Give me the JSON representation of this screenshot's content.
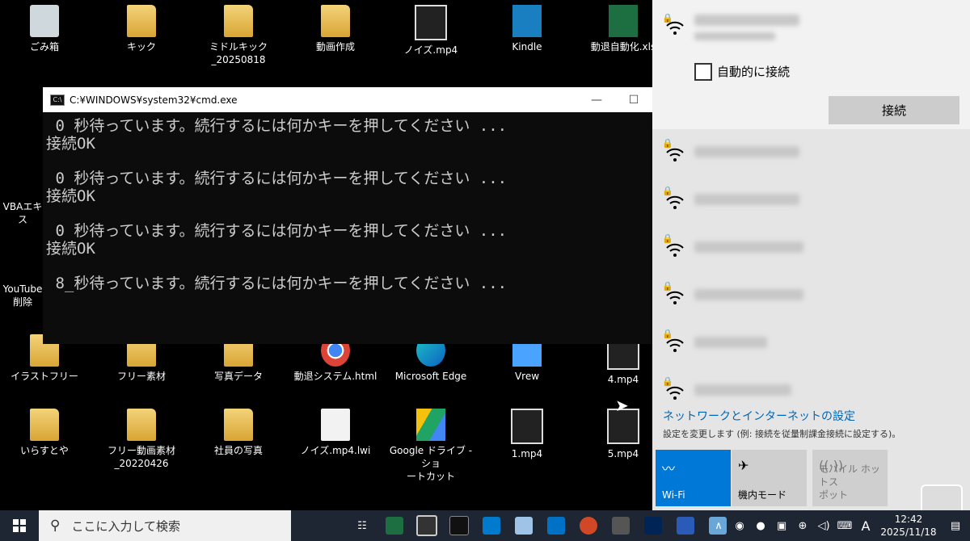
{
  "desktop": {
    "row1": [
      {
        "label": "ごみ箱",
        "kind": "trash"
      },
      {
        "label": "キック",
        "kind": "folder"
      },
      {
        "label": "ミドルキック\n_20250818",
        "kind": "folder"
      },
      {
        "label": "動画作成",
        "kind": "folder"
      },
      {
        "label": "ノイズ.mp4",
        "kind": "video"
      },
      {
        "label": "Kindle",
        "kind": "kindle"
      },
      {
        "label": "動退自動化.xls",
        "kind": "excel"
      }
    ],
    "left_partial": [
      {
        "label": "VBAエキス"
      },
      {
        "label": "YouTube"
      },
      {
        "label": "削除"
      }
    ],
    "row2": [
      {
        "label": "イラストフリー",
        "kind": "folder"
      },
      {
        "label": "フリー素材",
        "kind": "folder"
      },
      {
        "label": "写真データ",
        "kind": "folder"
      },
      {
        "label": "動退システム.html",
        "kind": "chrome"
      },
      {
        "label": "Microsoft Edge",
        "kind": "edge"
      },
      {
        "label": "Vrew",
        "kind": "vrew"
      },
      {
        "label": "4.mp4",
        "kind": "video"
      }
    ],
    "row3": [
      {
        "label": "いらすとや",
        "kind": "folder"
      },
      {
        "label": "フリー動画素材\n_20220426",
        "kind": "folder"
      },
      {
        "label": "社員の写真",
        "kind": "folder"
      },
      {
        "label": "ノイズ.mp4.lwi",
        "kind": "doc"
      },
      {
        "label": "Google ドライブ - ショ\nートカット",
        "kind": "gdrive"
      },
      {
        "label": "1.mp4",
        "kind": "video"
      },
      {
        "label": "5.mp4",
        "kind": "video"
      }
    ]
  },
  "cmd": {
    "title": "C:¥WINDOWS¥system32¥cmd.exe",
    "minimize": "—",
    "maximize": "☐",
    "lines": [
      " 0 秒待っています。続行するには何かキーを押してください ...",
      "接続OK",
      "",
      " 0 秒待っています。続行するには何かキーを押してください ...",
      "接続OK",
      "",
      " 0 秒待っています。続行するには何かキーを押してください ...",
      "接続OK",
      "",
      " 8_秒待っています。続行するには何かキーを押してください ..."
    ]
  },
  "wifi": {
    "auto_connect_label": "自動的に接続",
    "connect_button": "接続",
    "network_count": 6,
    "settings_link": "ネットワークとインターネットの設定",
    "settings_desc": "設定を変更します (例: 接続を従量制課金接続に設定する)。",
    "tiles": [
      {
        "label": "Wi-Fi",
        "icon": "wifi-icon",
        "active": true
      },
      {
        "label": "機内モード",
        "icon": "airplane-icon",
        "active": false
      },
      {
        "label": "モバイル ホットス\nポット",
        "icon": "hotspot-icon",
        "active": false
      }
    ],
    "accent": "#0078d7"
  },
  "taskbar": {
    "search_placeholder": "ここに入力して検索",
    "ime": "A",
    "time": "12:42",
    "date": "2025/11/18"
  }
}
